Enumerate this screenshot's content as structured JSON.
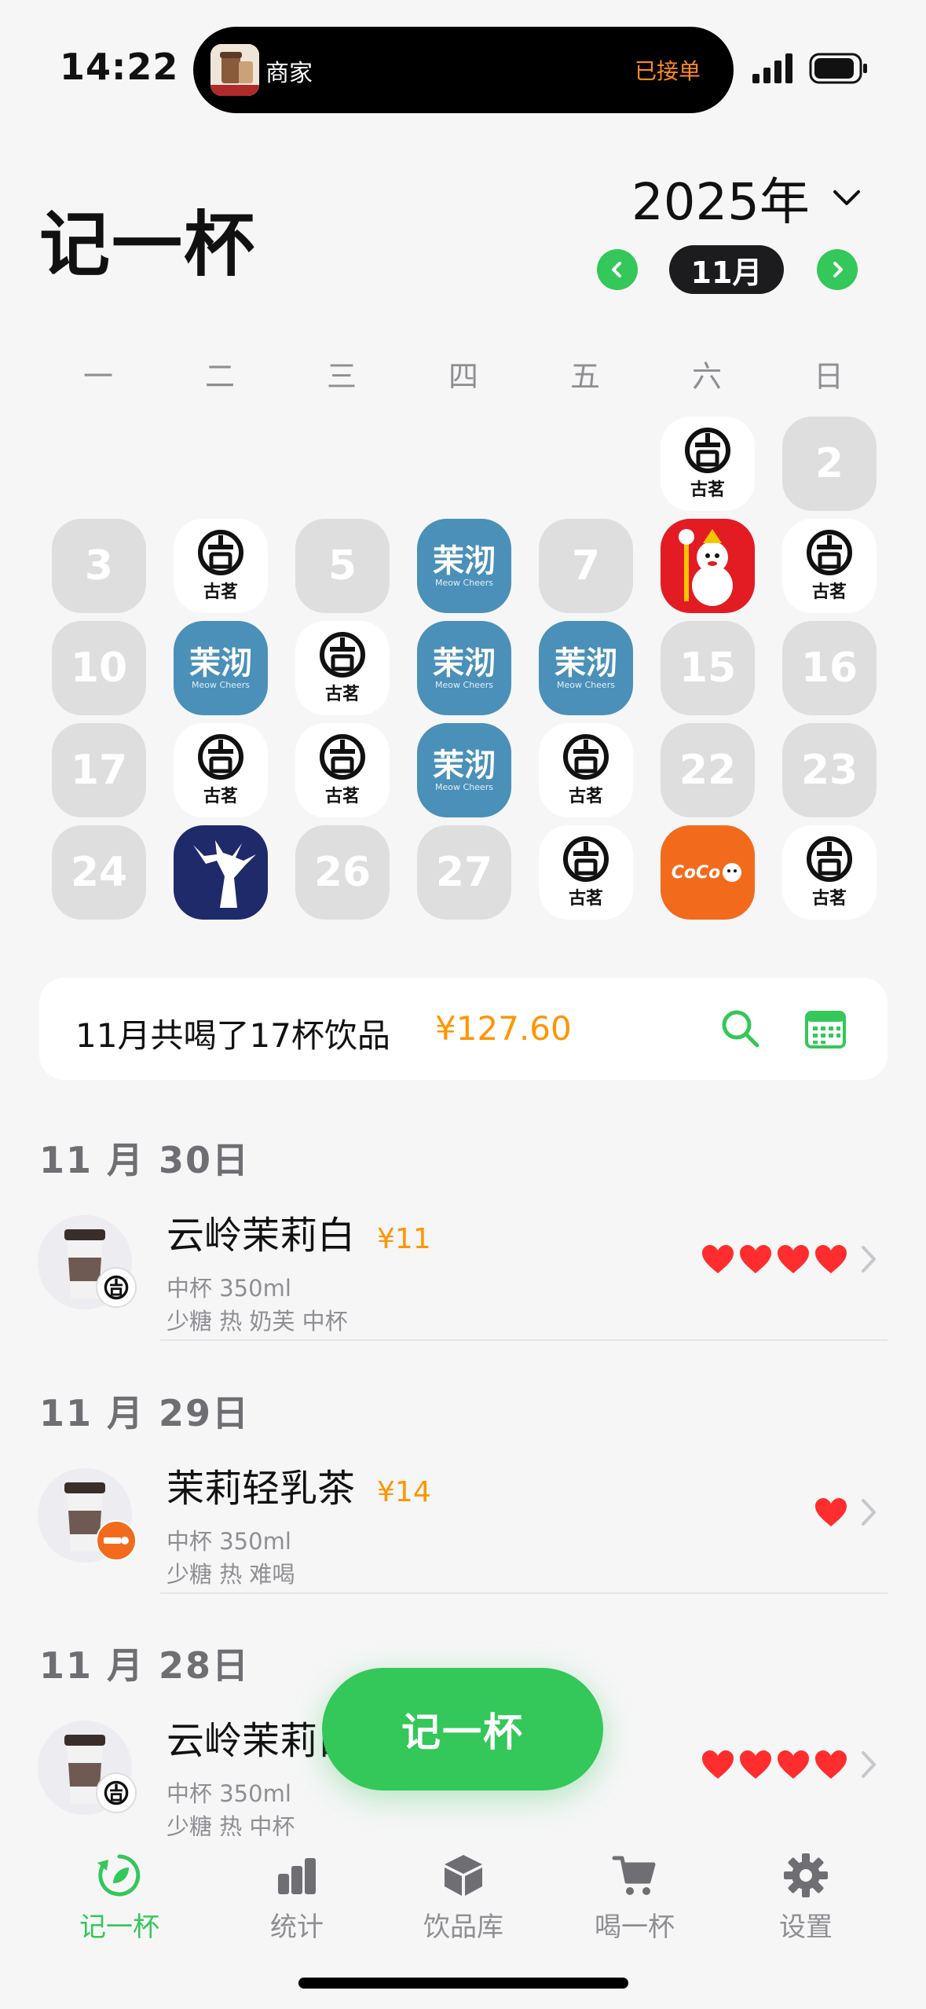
{
  "status": {
    "time": "14:22",
    "island_label": "商家",
    "island_status": "已接单"
  },
  "header": {
    "title": "记一杯",
    "year": "2025年",
    "month": "11月"
  },
  "calendar": {
    "weekdays": [
      "一",
      "二",
      "三",
      "四",
      "五",
      "六",
      "日"
    ],
    "days": [
      {
        "brand": "gu",
        "text": "古茗"
      },
      {
        "num": "2"
      },
      {
        "num": "3"
      },
      {
        "brand": "gu",
        "text": "古茗"
      },
      {
        "num": "5"
      },
      {
        "brand": "mo",
        "text": "茉沏",
        "sub": "Meow Cheers"
      },
      {
        "num": "7"
      },
      {
        "brand": "dq"
      },
      {
        "brand": "gu",
        "text": "古茗"
      },
      {
        "num": "10"
      },
      {
        "brand": "mo",
        "text": "茉沏",
        "sub": "Meow Cheers"
      },
      {
        "brand": "gu",
        "text": "古茗"
      },
      {
        "brand": "mo",
        "text": "茉沏",
        "sub": "Meow Cheers"
      },
      {
        "brand": "mo",
        "text": "茉沏",
        "sub": "Meow Cheers"
      },
      {
        "num": "15"
      },
      {
        "num": "16"
      },
      {
        "num": "17"
      },
      {
        "brand": "gu",
        "text": "古茗"
      },
      {
        "brand": "gu",
        "text": "古茗"
      },
      {
        "brand": "mo",
        "text": "茉沏",
        "sub": "Meow Cheers"
      },
      {
        "brand": "gu",
        "text": "古茗"
      },
      {
        "num": "22"
      },
      {
        "num": "23"
      },
      {
        "num": "24"
      },
      {
        "brand": "lu"
      },
      {
        "num": "26"
      },
      {
        "num": "27"
      },
      {
        "brand": "gu",
        "text": "古茗"
      },
      {
        "brand": "coco",
        "text": "CoCo"
      },
      {
        "brand": "gu",
        "text": "古茗"
      }
    ]
  },
  "summary": {
    "text": "11月共喝了17杯饮品",
    "amount": "¥127.60"
  },
  "records": [
    {
      "date": "11 月 30日",
      "name": "云岭茉莉白",
      "price": "¥11",
      "size": "中杯 350ml",
      "tags": "少糖  热  奶芙  中杯",
      "rating": 4,
      "brand": "gu"
    },
    {
      "date": "11 月 29日",
      "name": "茉莉轻乳茶",
      "price": "¥14",
      "size": "中杯 350ml",
      "tags": "少糖  热  难喝",
      "rating": 1,
      "brand": "coco"
    },
    {
      "date": "11 月 28日",
      "name": "云岭茉莉白",
      "price": "",
      "size": "中杯 350ml",
      "tags": "少糖  热  中杯",
      "rating": 4,
      "brand": "gu"
    }
  ],
  "fab": {
    "label": "记一杯"
  },
  "tabs": [
    {
      "label": "记一杯",
      "icon": "refresh-leaf-icon",
      "active": true
    },
    {
      "label": "统计",
      "icon": "bar-chart-icon",
      "active": false
    },
    {
      "label": "饮品库",
      "icon": "box-icon",
      "active": false
    },
    {
      "label": "喝一杯",
      "icon": "cart-icon",
      "active": false
    },
    {
      "label": "设置",
      "icon": "gear-icon",
      "active": false
    }
  ],
  "colors": {
    "accent": "#34c759",
    "price": "#ff9500",
    "heart": "#ff2d2d",
    "cell_empty": "#dedede",
    "moqi": "#4a90b8"
  }
}
